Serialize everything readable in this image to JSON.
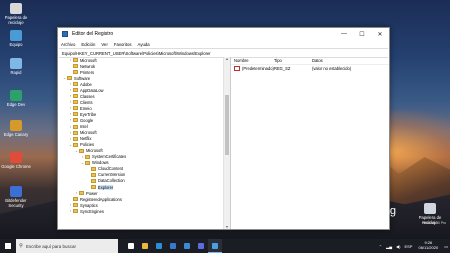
{
  "desktop_icons": [
    {
      "label": "Papelera de reciclaje",
      "color": "#d8d8d8"
    },
    {
      "label": "Equipo",
      "color": "#4a9ad6"
    },
    {
      "label": "Rapid",
      "color": "#7fb7e8"
    },
    {
      "label": "Edge Dev",
      "color": "#2aa26a"
    },
    {
      "label": "Edge Canary",
      "color": "#d59a2a"
    },
    {
      "label": "Google Chrome",
      "color": "#e14b3c"
    },
    {
      "label": "Bitdefender Security",
      "color": "#3b6fd6"
    }
  ],
  "desktop_icon_right": {
    "label": "Papelera de reciclaje"
  },
  "window": {
    "title": "Editor del Registro",
    "menu": [
      "Archivo",
      "Edición",
      "Ver",
      "Favoritos",
      "Ayuda"
    ],
    "address": "Equipo\\HKEY_CURRENT_USER\\Software\\Policies\\Microsoft\\Windows\\Explorer",
    "tree": [
      {
        "label": "Microsoft",
        "indent": 1,
        "expander": "›"
      },
      {
        "label": "Netwrok",
        "indent": 1,
        "expander": ""
      },
      {
        "label": "Printers",
        "indent": 1,
        "expander": ""
      },
      {
        "label": "Software",
        "indent": 0,
        "expander": "⌄"
      },
      {
        "label": "Adobe",
        "indent": 1,
        "expander": "›"
      },
      {
        "label": "AppDataLow",
        "indent": 1,
        "expander": "›"
      },
      {
        "label": "Classes",
        "indent": 1,
        "expander": "›"
      },
      {
        "label": "Clients",
        "indent": 1,
        "expander": "›"
      },
      {
        "label": "Emeio",
        "indent": 1,
        "expander": "›"
      },
      {
        "label": "EyeTribe",
        "indent": 1,
        "expander": "›"
      },
      {
        "label": "Google",
        "indent": 1,
        "expander": "›"
      },
      {
        "label": "Intel",
        "indent": 1,
        "expander": "›"
      },
      {
        "label": "Microsoft",
        "indent": 1,
        "expander": "›"
      },
      {
        "label": "Netflix",
        "indent": 1,
        "expander": "›"
      },
      {
        "label": "Policies",
        "indent": 1,
        "expander": "⌄"
      },
      {
        "label": "Microsoft",
        "indent": 2,
        "expander": "⌄"
      },
      {
        "label": "SystemCertificates",
        "indent": 3,
        "expander": "›"
      },
      {
        "label": "Windows",
        "indent": 3,
        "expander": "⌄"
      },
      {
        "label": "CloudContent",
        "indent": 4,
        "expander": ""
      },
      {
        "label": "CurrentVersion",
        "indent": 4,
        "expander": ""
      },
      {
        "label": "DataCollection",
        "indent": 4,
        "expander": ""
      },
      {
        "label": "Explorer",
        "indent": 4,
        "expander": "",
        "selected": true
      },
      {
        "label": "Power",
        "indent": 2,
        "expander": "›"
      },
      {
        "label": "RegisteredApplications",
        "indent": 1,
        "expander": ""
      },
      {
        "label": "Synaptics",
        "indent": 1,
        "expander": "›"
      },
      {
        "label": "SyncEngines",
        "indent": 1,
        "expander": "›"
      }
    ],
    "list_headers": {
      "name": "Nombre",
      "type": "Tipo",
      "data": "Datos"
    },
    "values": [
      {
        "name": "(Predeterminado)",
        "type": "REG_SZ",
        "data": "(valor no establecido)"
      }
    ]
  },
  "taskbar": {
    "search_placeholder": "Escribe aquí para buscar",
    "apps": [
      {
        "name": "task-view",
        "color": "#ffffff"
      },
      {
        "name": "file-explorer",
        "color": "#e8b93a"
      },
      {
        "name": "edge",
        "color": "#2b8fd6"
      },
      {
        "name": "mail",
        "color": "#3a78c9"
      },
      {
        "name": "store",
        "color": "#3a8ad6"
      },
      {
        "name": "photos",
        "color": "#5a6de0"
      },
      {
        "name": "regedit",
        "color": "#4aa0e0",
        "active": true
      }
    ],
    "time": "9:26",
    "date": "06/11/2020",
    "lang": "ESP"
  },
  "watermark": {
    "bing": "Bing",
    "bing_sub": "",
    "build": "Windows 10 Pro"
  }
}
